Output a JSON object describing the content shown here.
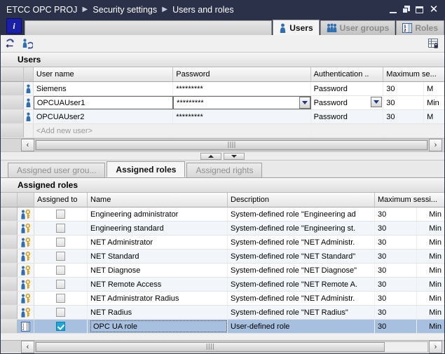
{
  "window": {
    "breadcrumb": [
      "ETCC OPC PROJ",
      "Security settings",
      "Users and roles"
    ],
    "controls": {
      "minimize": "_",
      "restore": "Restore",
      "maximize": "Maximize",
      "close": "✕"
    }
  },
  "tabstrip": {
    "info_label": "i",
    "tabs": [
      {
        "label": "Users",
        "icon": "user-icon",
        "active": true
      },
      {
        "label": "User groups",
        "icon": "user-group-icon",
        "active": false
      },
      {
        "label": "Roles",
        "icon": "roles-list-icon",
        "active": false
      }
    ]
  },
  "toolbar": {
    "buttons": [
      {
        "name": "sync-users-icon",
        "title": "Synchronize users"
      },
      {
        "name": "refresh-user-icon",
        "title": "Refresh user"
      }
    ],
    "right_button": {
      "name": "table-lock-icon",
      "title": "Protect table"
    }
  },
  "users_panel": {
    "title": "Users",
    "columns": [
      {
        "key": "gutter",
        "label": ""
      },
      {
        "key": "icon",
        "label": ""
      },
      {
        "key": "user_name",
        "label": "User name"
      },
      {
        "key": "password",
        "label": "Password"
      },
      {
        "key": "authentication",
        "label": "Authentication .."
      },
      {
        "key": "max_session",
        "label": "Maximum se..."
      },
      {
        "key": "unit",
        "label": ""
      }
    ],
    "rows": [
      {
        "user_name": "Siemens",
        "password": "*********",
        "authentication": "Password",
        "max_session": "30",
        "unit": "M",
        "state": "normal"
      },
      {
        "user_name": "OPCUAUser1",
        "password": "*********",
        "authentication": "Password",
        "max_session": "30",
        "unit": "Min",
        "state": "editing"
      },
      {
        "user_name": "OPCUAUser2",
        "password": "*********",
        "authentication": "Password",
        "max_session": "30",
        "unit": "M",
        "state": "normal"
      },
      {
        "user_name": "<Add new user>",
        "password": "",
        "authentication": "",
        "max_session": "",
        "unit": "",
        "state": "placeholder"
      }
    ],
    "scrollbar": {
      "left_arrow": "‹",
      "right_arrow": "›",
      "grip": "||||"
    }
  },
  "splitter": {
    "up_arrow": "up-arrow",
    "down_arrow": "down-arrow"
  },
  "lower_tabs": [
    {
      "label": "Assigned user grou...",
      "active": false
    },
    {
      "label": "Assigned roles",
      "active": true
    },
    {
      "label": "Assigned rights",
      "active": false
    }
  ],
  "roles_panel": {
    "title": "Assigned roles",
    "columns": [
      {
        "key": "gutter",
        "label": ""
      },
      {
        "key": "icon",
        "label": ""
      },
      {
        "key": "assigned_to",
        "label": "Assigned to"
      },
      {
        "key": "name",
        "label": "Name"
      },
      {
        "key": "description",
        "label": "Description"
      },
      {
        "key": "max_session",
        "label": "Maximum sessi..."
      },
      {
        "key": "unit",
        "label": ""
      }
    ],
    "rows": [
      {
        "checked": false,
        "name": "Engineering administrator",
        "description": "System-defined role \"Engineering ad",
        "max_session": "30",
        "unit": "Min",
        "icon": "user-key-icon",
        "selected": false
      },
      {
        "checked": false,
        "name": "Engineering standard",
        "description": "System-defined role \"Engineering st.",
        "max_session": "30",
        "unit": "Min",
        "icon": "user-key-icon",
        "selected": false
      },
      {
        "checked": false,
        "name": "NET Administrator",
        "description": "System-defined role \"NET Administr.",
        "max_session": "30",
        "unit": "Min",
        "icon": "user-key-icon",
        "selected": false
      },
      {
        "checked": false,
        "name": "NET Standard",
        "description": "System-defined role \"NET Standard\"",
        "max_session": "30",
        "unit": "Min",
        "icon": "user-key-icon",
        "selected": false
      },
      {
        "checked": false,
        "name": "NET Diagnose",
        "description": "System-defined role \"NET Diagnose\"",
        "max_session": "30",
        "unit": "Min",
        "icon": "user-key-icon",
        "selected": false
      },
      {
        "checked": false,
        "name": "NET Remote Access",
        "description": "System-defined role \"NET Remote A.",
        "max_session": "30",
        "unit": "Min",
        "icon": "user-key-icon",
        "selected": false
      },
      {
        "checked": false,
        "name": "NET Administrator Radius",
        "description": "System-defined role \"NET Administr.",
        "max_session": "30",
        "unit": "Min",
        "icon": "user-key-icon",
        "selected": false
      },
      {
        "checked": false,
        "name": "NET Radius",
        "description": "System-defined role \"NET Radius\"",
        "max_session": "30",
        "unit": "Min",
        "icon": "user-key-icon",
        "selected": false
      },
      {
        "checked": true,
        "name": "OPC UA role",
        "description": "User-defined role",
        "max_session": "30",
        "unit": "Min",
        "icon": "roles-list-icon",
        "selected": true
      }
    ],
    "scrollbar": {
      "left_arrow": "‹",
      "right_arrow": "›",
      "grip": "||||"
    }
  },
  "colors": {
    "titlebar": "#2b3148",
    "selection": "#a8c0e0",
    "accent_blue": "#1a1fa8",
    "checkbox_on": "#1ea7d6"
  }
}
